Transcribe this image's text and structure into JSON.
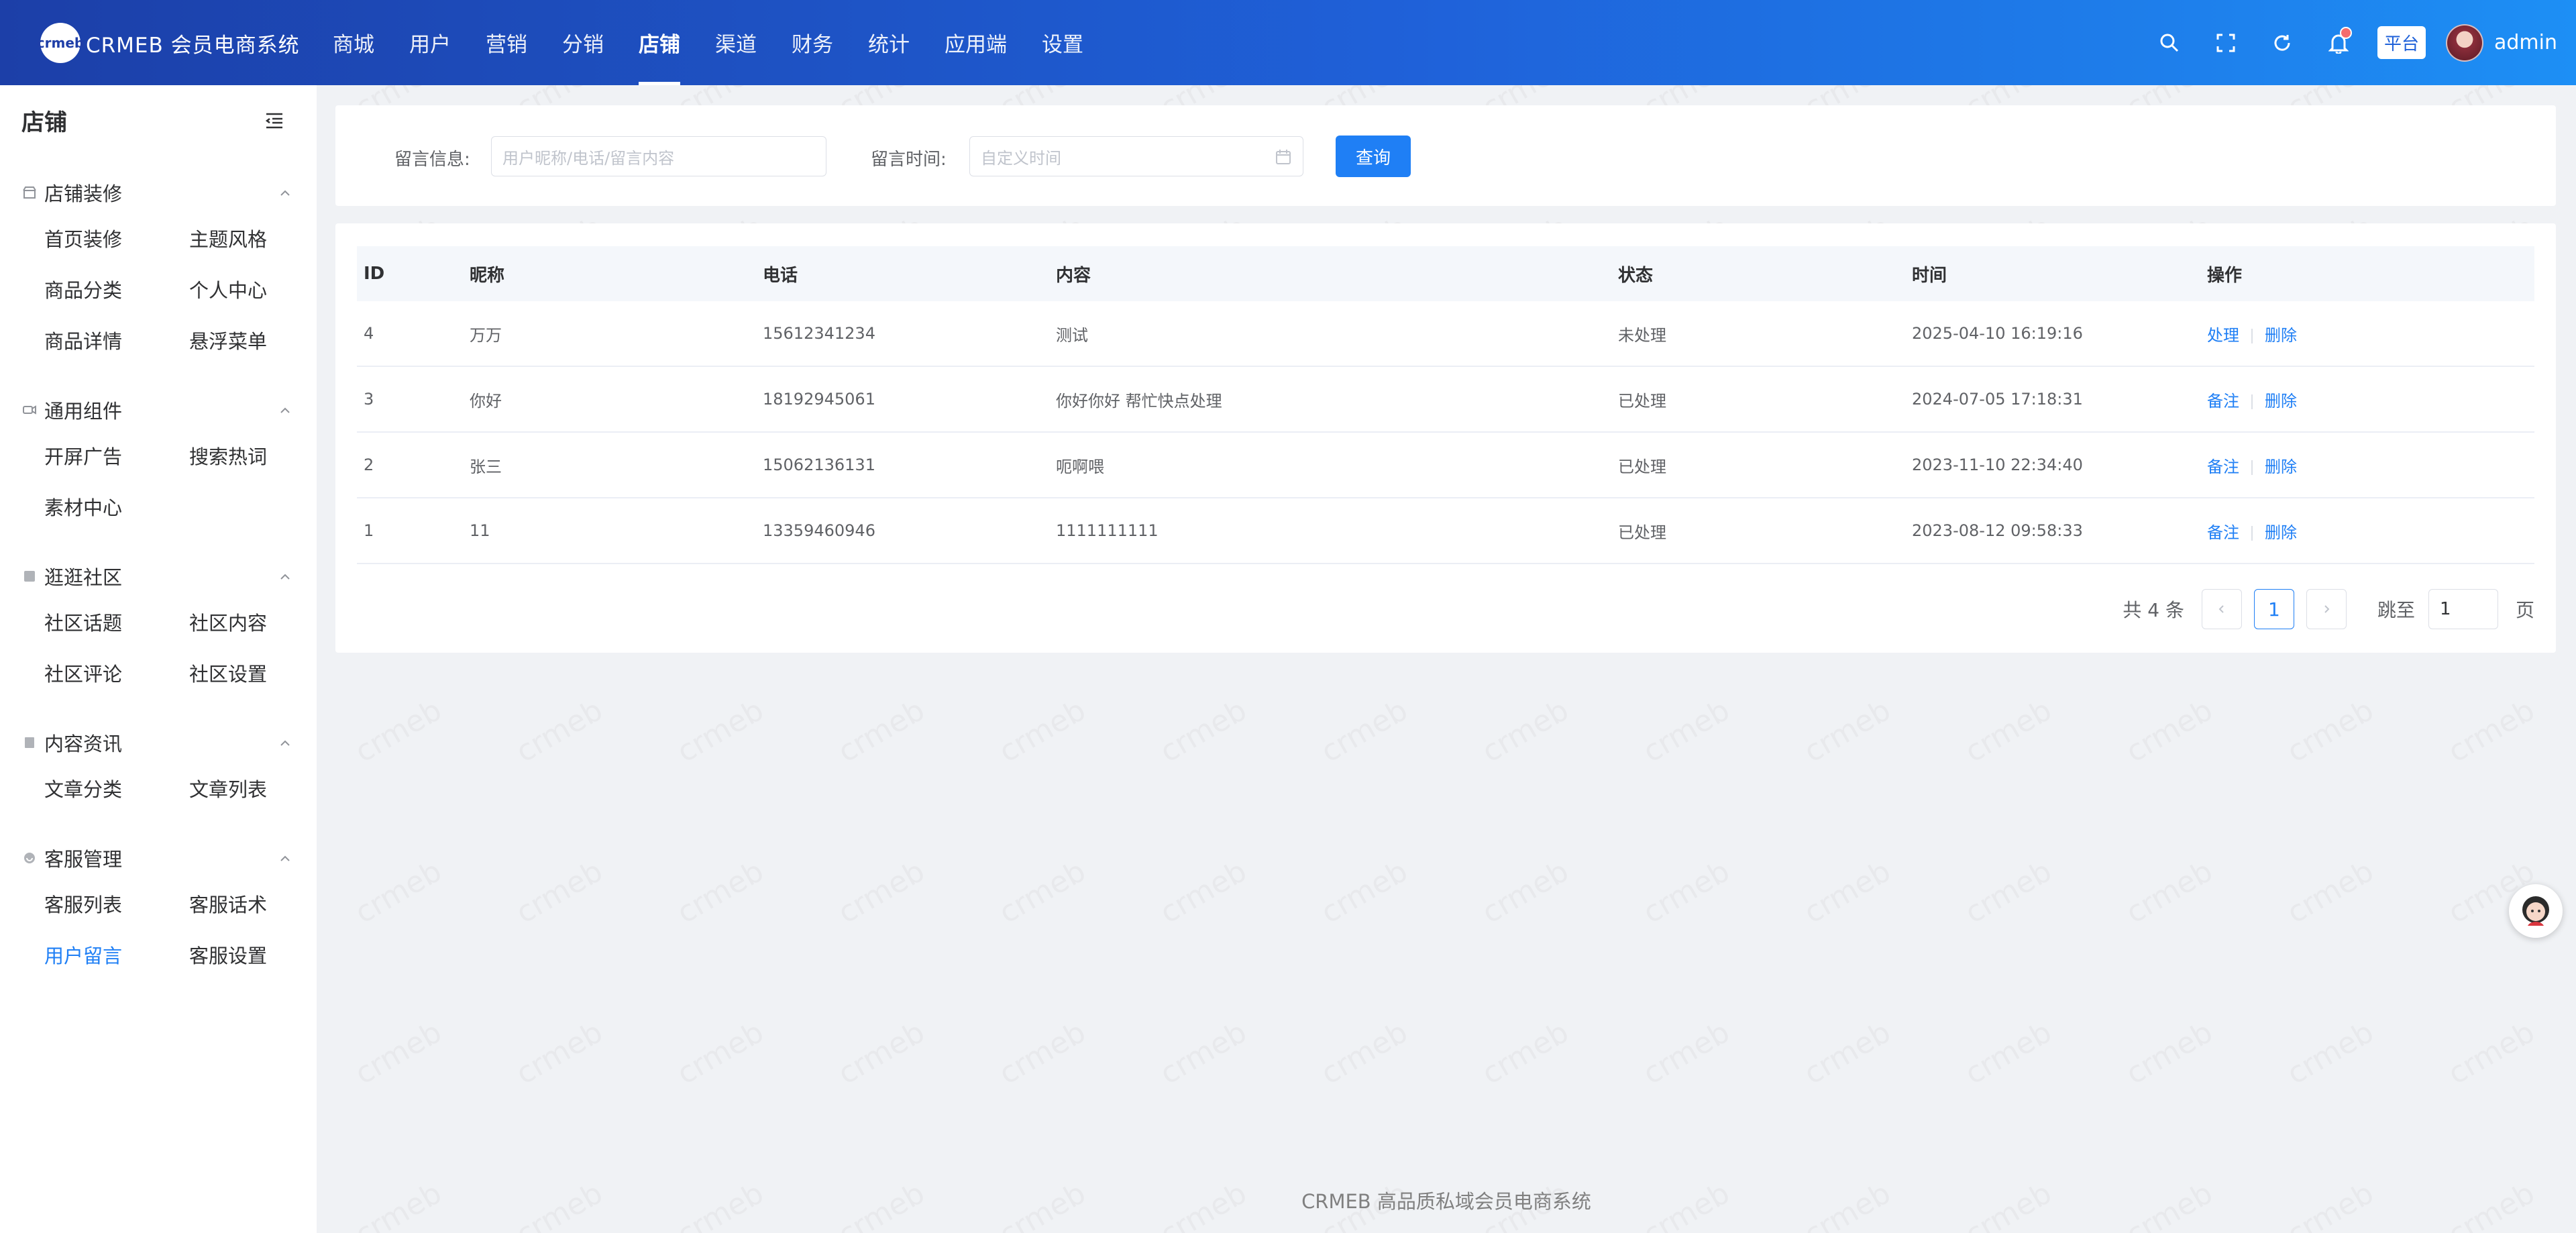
{
  "header": {
    "logo_mark": "crmeb",
    "logo_text": "CRMEB 会员电商系统",
    "nav": [
      {
        "label": "商城",
        "active": false
      },
      {
        "label": "用户",
        "active": false
      },
      {
        "label": "营销",
        "active": false
      },
      {
        "label": "分销",
        "active": false
      },
      {
        "label": "店铺",
        "active": true
      },
      {
        "label": "渠道",
        "active": false
      },
      {
        "label": "财务",
        "active": false
      },
      {
        "label": "统计",
        "active": false
      },
      {
        "label": "应用端",
        "active": false
      },
      {
        "label": "设置",
        "active": false
      }
    ],
    "platform_tag": "平台",
    "username": "admin"
  },
  "sidebar": {
    "title": "店铺",
    "groups": [
      {
        "label": "店铺装修",
        "icon": "store-icon",
        "items": [
          "首页装修",
          "主题风格",
          "商品分类",
          "个人中心",
          "商品详情",
          "悬浮菜单"
        ]
      },
      {
        "label": "通用组件",
        "icon": "component-icon",
        "items": [
          "开屏广告",
          "搜索热词",
          "素材中心"
        ]
      },
      {
        "label": "逛逛社区",
        "icon": "community-icon",
        "items": [
          "社区话题",
          "社区内容",
          "社区评论",
          "社区设置"
        ]
      },
      {
        "label": "内容资讯",
        "icon": "article-icon",
        "items": [
          "文章分类",
          "文章列表"
        ]
      },
      {
        "label": "客服管理",
        "icon": "service-icon",
        "items": [
          "客服列表",
          "客服话术",
          "用户留言",
          "客服设置"
        ]
      }
    ],
    "active_item": "用户留言"
  },
  "search": {
    "message_label": "留言信息:",
    "message_placeholder": "用户昵称/电话/留言内容",
    "time_label": "留言时间:",
    "time_placeholder": "自定义时间",
    "query_button": "查询"
  },
  "table": {
    "columns": [
      "ID",
      "昵称",
      "电话",
      "内容",
      "状态",
      "时间",
      "操作"
    ],
    "rows": [
      {
        "id": "4",
        "nickname": "万万",
        "phone": "15612341234",
        "content": "测试",
        "status": "未处理",
        "time": "2025-04-10 16:19:16",
        "action": "处理",
        "delete": "删除"
      },
      {
        "id": "3",
        "nickname": "你好",
        "phone": "18192945061",
        "content": "你好你好 帮忙快点处理",
        "status": "已处理",
        "time": "2024-07-05 17:18:31",
        "action": "备注",
        "delete": "删除"
      },
      {
        "id": "2",
        "nickname": "张三",
        "phone": "15062136131",
        "content": "呃啊喂",
        "status": "已处理",
        "time": "2023-11-10 22:34:40",
        "action": "备注",
        "delete": "删除"
      },
      {
        "id": "1",
        "nickname": "11",
        "phone": "13359460946",
        "content": "1111111111",
        "status": "已处理",
        "time": "2023-08-12 09:58:33",
        "action": "备注",
        "delete": "删除"
      }
    ]
  },
  "pagination": {
    "total_text": "共 4 条",
    "current_page": "1",
    "jump_label": "跳至",
    "jump_value": "1",
    "page_suffix": "页"
  },
  "footer": {
    "text": "CRMEB 高品质私域会员电商系统"
  },
  "colors": {
    "primary": "#1f7ff5",
    "header_start": "#1c3fa8",
    "header_end": "#1d8ff5"
  }
}
